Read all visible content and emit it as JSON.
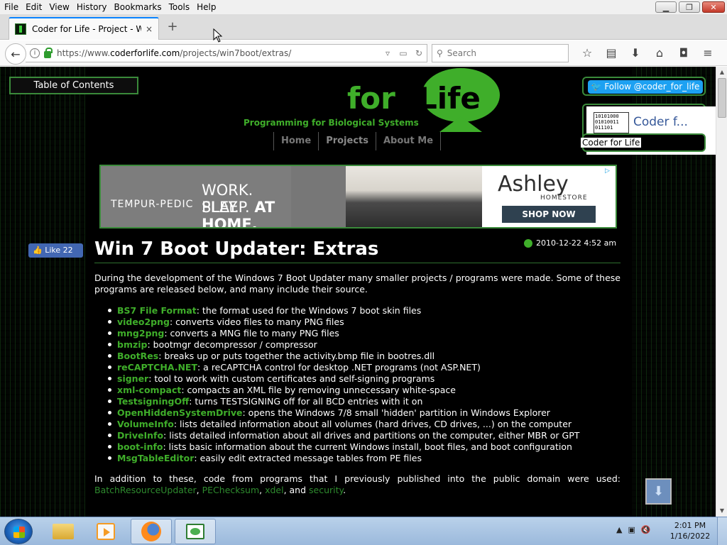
{
  "menu": [
    "File",
    "Edit",
    "View",
    "History",
    "Bookmarks",
    "Tools",
    "Help"
  ],
  "window_controls": {
    "minimize": "▁",
    "restore": "❐",
    "close": "✕"
  },
  "tab": {
    "title": "Coder for Life - Project - W...",
    "close": "×",
    "new_tab": "+"
  },
  "nav": {
    "back": "←",
    "info": "i",
    "url_host_prefix": "https://www.",
    "url_host": "coderforlife.com",
    "url_path": "/projects/win7boot/extras/",
    "search_placeholder": "Search",
    "search_icon": "⚲",
    "icons": [
      "☆",
      "▤",
      "⬇",
      "⌂",
      "◘",
      "≡"
    ]
  },
  "site": {
    "toc": "Table of Contents",
    "logo_for": "for",
    "logo_life": "Life",
    "tagline": "Programming for Biological Systems",
    "nav": [
      "Home",
      "Projects",
      "About Me"
    ],
    "twitter_follow": "Follow @coder_for_life",
    "fb_page_name": "Coder f...",
    "fb_thumb_text": "10101000\n01010011\n011101",
    "fb_caption": "Coder for Life"
  },
  "ad": {
    "brand": "TEMPUR-PEDIC",
    "headline1": "WORK. PLAY.",
    "headline2_a": "SLEEP. ",
    "headline2_b": "AT HOME.",
    "advertiser": "Ashley",
    "advertiser_sub": "HOMESTORE",
    "cta": "SHOP NOW",
    "adchoices": "▷"
  },
  "article": {
    "fb_like": "Like 22",
    "title": "Win 7 Boot Updater: Extras",
    "date": "2010-12-22 4:52 am",
    "intro": "During the development of the Windows 7 Boot Updater many smaller projects / programs were made. Some of these programs are released below, and many include their source.",
    "items": [
      {
        "name": "BS7 File Format",
        "desc": ": the format used for the Windows 7 boot skin files"
      },
      {
        "name": "video2png",
        "desc": ": converts video files to many PNG files"
      },
      {
        "name": "mng2png",
        "desc": ": converts a MNG file to many PNG files"
      },
      {
        "name": "bmzip",
        "desc": ": bootmgr decompressor / compressor"
      },
      {
        "name": "BootRes",
        "desc": ": breaks up or puts together the activity.bmp file in bootres.dll"
      },
      {
        "name": "reCAPTCHA.NET",
        "desc": ": a reCAPTCHA control for desktop .NET programs (not ASP.NET)"
      },
      {
        "name": "signer",
        "desc": ": tool to work with custom certificates and self-signing programs"
      },
      {
        "name": "xml-compact",
        "desc": ": compacts an XML file by removing unnecessary white-space"
      },
      {
        "name": "TestsigningOff",
        "desc": ": turns TESTSIGNING off for all BCD entries with it on"
      },
      {
        "name": "OpenHiddenSystemDrive",
        "desc": ": opens the Windows 7/8 small 'hidden' partition in Windows Explorer"
      },
      {
        "name": "VolumeInfo",
        "desc": ": lists detailed information about all volumes (hard drives, CD drives, ...) on the computer"
      },
      {
        "name": "DriveInfo",
        "desc": ": lists detailed information about all drives and partitions on the computer, either MBR or GPT"
      },
      {
        "name": "boot-info",
        "desc": ": lists basic information about the current Windows install, boot files, and boot configuration"
      },
      {
        "name": "MsgTableEditor",
        "desc": ": easily edit extracted message tables from PE files"
      }
    ],
    "outro_text": "In addition to these, code from programs that I previously published into the public domain were used: ",
    "outro_links": [
      "BatchResourceUpdater",
      "PEChecksum",
      "xdel",
      "security"
    ],
    "outro_sep1": ", ",
    "outro_sep2": ", ",
    "outro_sep3": ", and ",
    "outro_end": ".",
    "scroll_top": "⬇"
  },
  "taskbar": {
    "time": "2:01 PM",
    "date": "1/16/2022",
    "tray_icons": [
      "▲",
      "▣",
      "🔇"
    ]
  },
  "colors": {
    "accent_green": "#3fae2a",
    "page_bg": "#000000",
    "twitter_blue": "#1da1f2",
    "facebook_blue": "#4267b2",
    "firefox_tab_accent": "#0a84ff"
  }
}
